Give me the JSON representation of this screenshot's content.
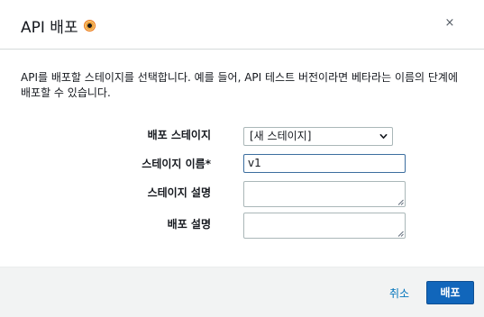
{
  "dialog": {
    "title": "API 배포",
    "close_label": "×",
    "description": "API를 배포할 스테이지를 선택합니다. 예를 들어, API 테스트 버전이라면 베타라는 이름의 단계에 배포할 수 있습니다."
  },
  "form": {
    "stage_label": "배포 스테이지",
    "stage_selected": "[새 스테이지]",
    "stage_name_label": "스테이지 이름*",
    "stage_name_value": "v1",
    "stage_desc_label": "스테이지 설명",
    "stage_desc_value": "",
    "deploy_desc_label": "배포 설명",
    "deploy_desc_value": ""
  },
  "footer": {
    "cancel_label": "취소",
    "deploy_label": "배포"
  },
  "colors": {
    "primary": "#1166bb",
    "link": "#0073bb",
    "info_icon": "#ec7211"
  },
  "icons": {
    "info": "info-icon",
    "close": "close-icon",
    "dropdown": "chevron-down-icon"
  }
}
